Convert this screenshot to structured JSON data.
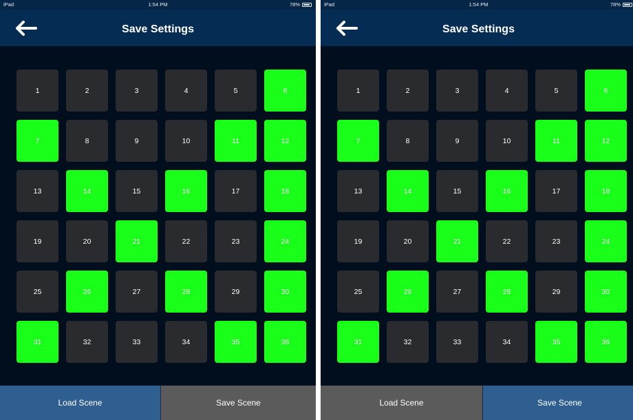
{
  "screens": [
    {
      "status": {
        "carrier": "iPad",
        "time": "1:54 PM",
        "battery": "78%",
        "battery_level": 0.78
      },
      "nav": {
        "title": "Save Settings",
        "back_icon": "arrow-left-icon"
      },
      "active_cells": [
        6,
        7,
        11,
        12,
        14,
        16,
        18,
        21,
        24,
        26,
        28,
        30,
        31,
        35,
        36
      ],
      "buttons": {
        "load": "Load Scene",
        "save": "Save Scene"
      },
      "selected_button": "save"
    },
    {
      "status": {
        "carrier": "iPad",
        "time": "1:54 PM",
        "battery": "78%",
        "battery_level": 0.78
      },
      "nav": {
        "title": "Save Settings",
        "back_icon": "arrow-left-icon"
      },
      "active_cells": [
        6,
        7,
        11,
        12,
        14,
        16,
        18,
        21,
        24,
        26,
        28,
        30,
        31,
        35,
        36
      ],
      "buttons": {
        "load": "Load Scene",
        "save": "Save Scene"
      },
      "selected_button": "load"
    }
  ],
  "colors": {
    "active": "#19ff19",
    "inactive": "#2a2b2e",
    "background": "#010e1e",
    "navbar": "#052d54",
    "button_blue": "#2f5f91",
    "button_gray": "#5b5b5b"
  }
}
